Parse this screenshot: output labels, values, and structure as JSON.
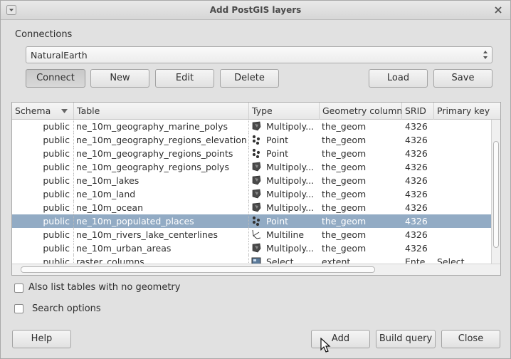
{
  "window": {
    "title": "Add PostGIS layers"
  },
  "connections": {
    "label": "Connections",
    "selected": "NaturalEarth",
    "buttons": {
      "connect": "Connect",
      "new": "New",
      "edit": "Edit",
      "delete": "Delete",
      "load": "Load",
      "save": "Save"
    }
  },
  "table": {
    "columns": [
      "Schema",
      "Table",
      "Type",
      "Geometry column",
      "SRID",
      "Primary key"
    ],
    "rows": [
      {
        "schema": "public",
        "table": "ne_10m_geography_marine_polys",
        "type": "Multipoly...",
        "type_icon": "polygon-icon",
        "geom": "the_geom",
        "srid": "4326",
        "pk": ""
      },
      {
        "schema": "public",
        "table": "ne_10m_geography_regions_elevation...",
        "type": "Point",
        "type_icon": "point-icon",
        "geom": "the_geom",
        "srid": "4326",
        "pk": ""
      },
      {
        "schema": "public",
        "table": "ne_10m_geography_regions_points",
        "type": "Point",
        "type_icon": "point-icon",
        "geom": "the_geom",
        "srid": "4326",
        "pk": ""
      },
      {
        "schema": "public",
        "table": "ne_10m_geography_regions_polys",
        "type": "Multipoly...",
        "type_icon": "polygon-icon",
        "geom": "the_geom",
        "srid": "4326",
        "pk": ""
      },
      {
        "schema": "public",
        "table": "ne_10m_lakes",
        "type": "Multipoly...",
        "type_icon": "polygon-icon",
        "geom": "the_geom",
        "srid": "4326",
        "pk": ""
      },
      {
        "schema": "public",
        "table": "ne_10m_land",
        "type": "Multipoly...",
        "type_icon": "polygon-icon",
        "geom": "the_geom",
        "srid": "4326",
        "pk": ""
      },
      {
        "schema": "public",
        "table": "ne_10m_ocean",
        "type": "Multipoly...",
        "type_icon": "polygon-icon",
        "geom": "the_geom",
        "srid": "4326",
        "pk": ""
      },
      {
        "schema": "public",
        "table": "ne_10m_populated_places",
        "type": "Point",
        "type_icon": "point-icon",
        "geom": "the_geom",
        "srid": "4326",
        "pk": "",
        "selected": true
      },
      {
        "schema": "public",
        "table": "ne_10m_rivers_lake_centerlines",
        "type": "Multiline",
        "type_icon": "line-icon",
        "geom": "the_geom",
        "srid": "4326",
        "pk": ""
      },
      {
        "schema": "public",
        "table": "ne_10m_urban_areas",
        "type": "Multipoly...",
        "type_icon": "polygon-icon",
        "geom": "the_geom",
        "srid": "4326",
        "pk": ""
      },
      {
        "schema": "public",
        "table": "raster_columns",
        "type": "Select...",
        "type_icon": "raster-icon",
        "geom": "extent",
        "srid": "Ente...",
        "pk": "Select..."
      }
    ]
  },
  "options": {
    "no_geometry": "Also list tables with no geometry",
    "search": "Search options"
  },
  "footer": {
    "help": "Help",
    "add": "Add",
    "build_query": "Build query",
    "close": "Close"
  }
}
